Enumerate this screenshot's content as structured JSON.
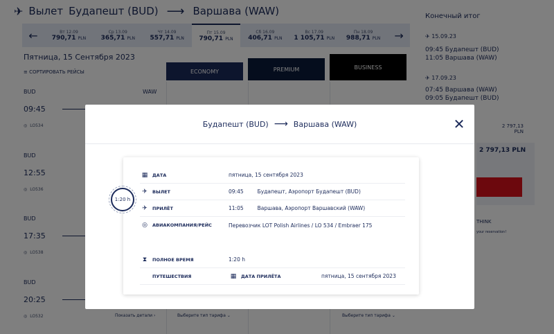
{
  "route": {
    "prefix": "Вылет",
    "from": "Будапешт (BUD)",
    "to": "Варшава (WAW)"
  },
  "dates": [
    {
      "day": "Вт 12.09",
      "price": "790,71",
      "cur": "PLN"
    },
    {
      "day": "Ср 13.09",
      "price": "365,71",
      "cur": "PLN"
    },
    {
      "day": "Чт 14.09",
      "price": "557,71",
      "cur": "PLN"
    },
    {
      "day": "Пт 15.09",
      "price": "790,71",
      "cur": "PLN"
    },
    {
      "day": "Сб 16.09",
      "price": "406,71",
      "cur": "PLN"
    },
    {
      "day": "Вс 17.09",
      "price": "1 105,71",
      "cur": "PLN"
    },
    {
      "day": "Пн 18.09",
      "price": "988,71",
      "cur": "PLN"
    }
  ],
  "day_title": "Пятница, 15 Сентября 2023",
  "sort_label": "СОРТИРОВАТЬ РЕЙСЫ",
  "fares": {
    "economy": "ECONOMY",
    "premium": "PREMIUM",
    "business": "BUSINESS"
  },
  "waw": "WAW",
  "flights": [
    {
      "code": "BUD",
      "time": "09:45",
      "flight": "LO534"
    },
    {
      "code": "BUD",
      "time": "12:55",
      "flight": "LO536"
    },
    {
      "code": "BUD",
      "time": "17:35",
      "flight": "LO538"
    },
    {
      "code": "BUD",
      "time": "20:25",
      "flight": "LO532"
    }
  ],
  "bottom": {
    "details": "Показать детали",
    "pick1": "Выберите тип тарифа",
    "pick2": "Выберите тип тарифа"
  },
  "summary": {
    "title": "Конечный итог",
    "seg1_date": "15.09.23",
    "seg1_dep": "09:45  Будапешт  (BUD)",
    "seg1_arr": "11:05  Варшава  (WAW)",
    "seg2_date": "17.09.23",
    "seg2_dep": "07:45  Варшава  (WAW)",
    "seg2_arr": "09:05  Будапешт  (BUD)",
    "total_small": "2 797,13",
    "total_small_cur": "PLN",
    "total_big": "2 797,13 PLN",
    "think": "THINK",
    "reserve": "your reservation!"
  },
  "modal": {
    "from": "Будапешт (BUD)",
    "to": "Варшава (WAW)",
    "duration_badge": "1:20 h",
    "rows": {
      "date_label": "ДАТА",
      "date_value": "пятница, 15 сентября 2023",
      "dep_label": "ВЫЛЕТ",
      "dep_time": "09:45",
      "dep_place": "Будапешт, Аэропорт Будапешт (BUD)",
      "arr_label": "ПРИЛЁТ",
      "arr_time": "11:05",
      "arr_place": "Варшава, Аэропорт Варшавский (WAW)",
      "airline_label": "АВИАКОМПАНИЯ/РЕЙС",
      "airline_value": "Перевозчик LOT Polish Airlines / LO 534 / Embraer 175",
      "total_label": "ПОЛНОЕ ВРЕМЯ",
      "total_value": "1:20 h",
      "trip_label": "ПУТЕШЕСТВИЯ",
      "arrival_date_label": "ДАТА ПРИЛЁТА",
      "arrival_date_value": "пятница, 15 сентября 2023"
    }
  }
}
